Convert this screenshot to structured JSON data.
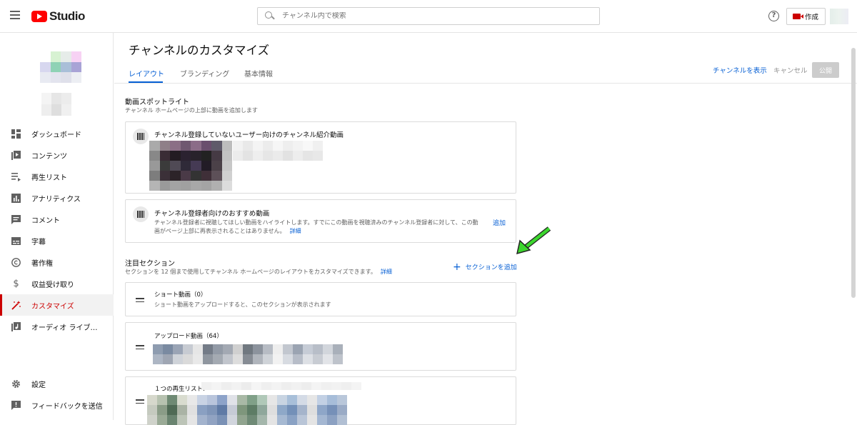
{
  "topbar": {
    "logo_text": "Studio",
    "search_placeholder": "チャンネル内で検索",
    "create_label": "作成"
  },
  "sidebar": {
    "items": [
      {
        "label": "ダッシュボード",
        "icon": "dashboard-icon"
      },
      {
        "label": "コンテンツ",
        "icon": "content-icon"
      },
      {
        "label": "再生リスト",
        "icon": "playlist-icon"
      },
      {
        "label": "アナリティクス",
        "icon": "analytics-icon"
      },
      {
        "label": "コメント",
        "icon": "comment-icon"
      },
      {
        "label": "字幕",
        "icon": "subtitles-icon"
      },
      {
        "label": "著作権",
        "icon": "copyright-icon"
      },
      {
        "label": "収益受け取り",
        "icon": "dollar-icon"
      },
      {
        "label": "カスタマイズ",
        "icon": "magic-wand-icon",
        "active": true
      },
      {
        "label": "オーディオ ライブ…",
        "icon": "audio-library-icon"
      }
    ],
    "bottom": [
      {
        "label": "設定",
        "icon": "gear-icon"
      },
      {
        "label": "フィードバックを送信",
        "icon": "feedback-icon"
      }
    ]
  },
  "main": {
    "title": "チャンネルのカスタマイズ",
    "tabs": [
      "レイアウト",
      "ブランディング",
      "基本情報"
    ],
    "view_channel": "チャンネルを表示",
    "cancel": "キャンセル",
    "publish": "公開",
    "spotlight": {
      "title": "動画スポットライト",
      "desc": "チャンネル ホームページの上部に動画を追加します",
      "trailer_title": "チャンネル登録していないユーザー向けのチャンネル紹介動画",
      "featured_title": "チャンネル登録者向けのおすすめ動画",
      "featured_desc_1": "チャンネル登録者に視聴してほしい動画をハイライトします。すでにこの動画を視聴済みのチャンネル登録者に対して、この動",
      "featured_desc_2": "画がページ上部に再表示されることはありません。",
      "details": "詳細",
      "add": "追加"
    },
    "featured_sections": {
      "title": "注目セクション",
      "desc": "セクションを 12 個まで使用してチャンネル ホームページのレイアウトをカスタマイズできます。",
      "details": "詳細",
      "add_section": "セクションを追加",
      "sections": [
        {
          "title": "ショート動画（0）",
          "desc": "ショート動画をアップロードすると、このセクションが表示されます"
        },
        {
          "title": "アップロード動画（64）"
        },
        {
          "title": "１つの再生リスト:"
        }
      ]
    }
  },
  "colors": {
    "accent": "#065fd4",
    "brand_red": "#ff0000",
    "active_red": "#cc0000",
    "arrow_green": "#3cd62e"
  }
}
